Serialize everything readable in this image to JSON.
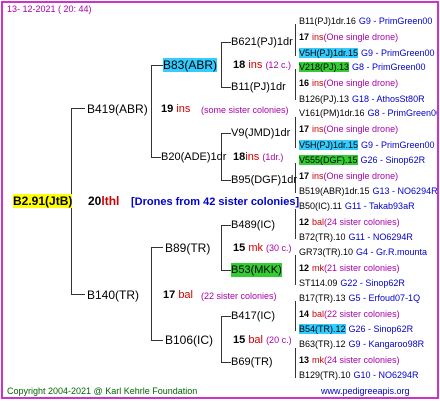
{
  "header": {
    "timestamp": "13- 12-2021 ( 20: 44)"
  },
  "footer": {
    "copyright": "Copyright 2004-2021 @ Karl Kehrle Foundation",
    "site": "www.pedigreeapis.org"
  },
  "root": {
    "id": "B2.91(JtB)",
    "year": "20",
    "breeder": "lthl",
    "note": "[Drones from 42 sister colonies]"
  },
  "gen1": [
    {
      "id": "B419(ABR)",
      "year": "19",
      "breeder": "ins",
      "note": "(some sister colonies)"
    },
    {
      "id": "B140(TR)",
      "year": "17",
      "breeder": "bal",
      "note": "(22 sister colonies)"
    }
  ],
  "gen2": [
    {
      "id": "B83(ABR)",
      "year": "18",
      "breeder": "ins",
      "note": "(12 c.)"
    },
    {
      "id": "B20(ADE)1dr",
      "year": "18",
      "breeder": "ins",
      "note": "(1dr.)"
    },
    {
      "id": "B89(TR)",
      "year": "15",
      "breeder": "mk",
      "note": "(30 c.)"
    },
    {
      "id": "B106(IC)",
      "year": "15",
      "breeder": "bal",
      "note": "(20 c.)"
    }
  ],
  "gen3": [
    {
      "id": "B621(PJ)1dr"
    },
    {
      "id": "B11(PJ)1dr"
    },
    {
      "id": "V9(JMD)1dr"
    },
    {
      "id": "B95(DGF)1dr"
    },
    {
      "id": "B489(IC)"
    },
    {
      "id": "B53(MKK)"
    },
    {
      "id": "B417(IC)"
    },
    {
      "id": "B69(TR)"
    }
  ],
  "gen4": [
    {
      "kind": "queen",
      "name": "B11(PJ)1dr.16",
      "hl": "",
      "src": "G9 - PrimGreen00"
    },
    {
      "kind": "drone",
      "year": "17",
      "breeder": "ins",
      "note": "(One single drone)"
    },
    {
      "kind": "queen",
      "name": "V5H(PJ)1dr.15",
      "hl": "cyan",
      "src": "G9 - PrimGreen00"
    },
    {
      "kind": "queen",
      "name": "V218(PJ).13",
      "hl": "green",
      "src": "G8 - PrimGreen00"
    },
    {
      "kind": "drone",
      "year": "16",
      "breeder": "ins",
      "note": "(One single drone)"
    },
    {
      "kind": "queen",
      "name": "B126(PJ).13",
      "hl": "",
      "src": "G18 - AthosSt80R"
    },
    {
      "kind": "queen",
      "name": "V161(PM)1dr.16",
      "hl": "",
      "src": "G8 - PrimGreen00"
    },
    {
      "kind": "drone",
      "year": "17",
      "breeder": "ins",
      "note": "(One single drone)"
    },
    {
      "kind": "queen",
      "name": "V5H(PJ)1dr.15",
      "hl": "cyan",
      "src": "G9 - PrimGreen00"
    },
    {
      "kind": "queen",
      "name": "V555(DGF).15",
      "hl": "green",
      "src": "G26 - Sinop62R"
    },
    {
      "kind": "drone",
      "year": "17",
      "breeder": "ins",
      "note": "(One single drone)"
    },
    {
      "kind": "queen",
      "name": "B519(ABR)1dr.15",
      "hl": "",
      "src": "G13 - NO6294R"
    },
    {
      "kind": "queen",
      "name": "B50(IC).11",
      "hl": "",
      "src": "G11 - Takab93aR"
    },
    {
      "kind": "drone",
      "year": "12",
      "breeder": "bal",
      "note": "(24 sister colonies)"
    },
    {
      "kind": "queen",
      "name": "B72(TR).10",
      "hl": "",
      "src": "G11 - NO6294R"
    },
    {
      "kind": "queen",
      "name": "GR73(TR).10",
      "hl": "",
      "src": "G4 - Gr.R.mounta"
    },
    {
      "kind": "drone",
      "year": "12",
      "breeder": "mk",
      "note": "(21 sister colonies)"
    },
    {
      "kind": "queen",
      "name": "ST114.09",
      "hl": "",
      "src": "G22 - Sinop62R"
    },
    {
      "kind": "queen",
      "name": "B17(TR).13",
      "hl": "",
      "src": "G5 - Erfoud07-1Q"
    },
    {
      "kind": "drone",
      "year": "14",
      "breeder": "bal",
      "note": "(22 sister colonies)"
    },
    {
      "kind": "queen",
      "name": "B54(TR).12",
      "hl": "cyan",
      "src": "G26 - Sinop62R"
    },
    {
      "kind": "queen",
      "name": "B63(TR).12",
      "hl": "",
      "src": "G9 - Kangaroo98R"
    },
    {
      "kind": "drone",
      "year": "13",
      "breeder": "mk",
      "note": "(24 sister colonies)"
    },
    {
      "kind": "queen",
      "name": "B129(TR).10",
      "hl": "",
      "src": "G10 - NO6294R"
    }
  ]
}
